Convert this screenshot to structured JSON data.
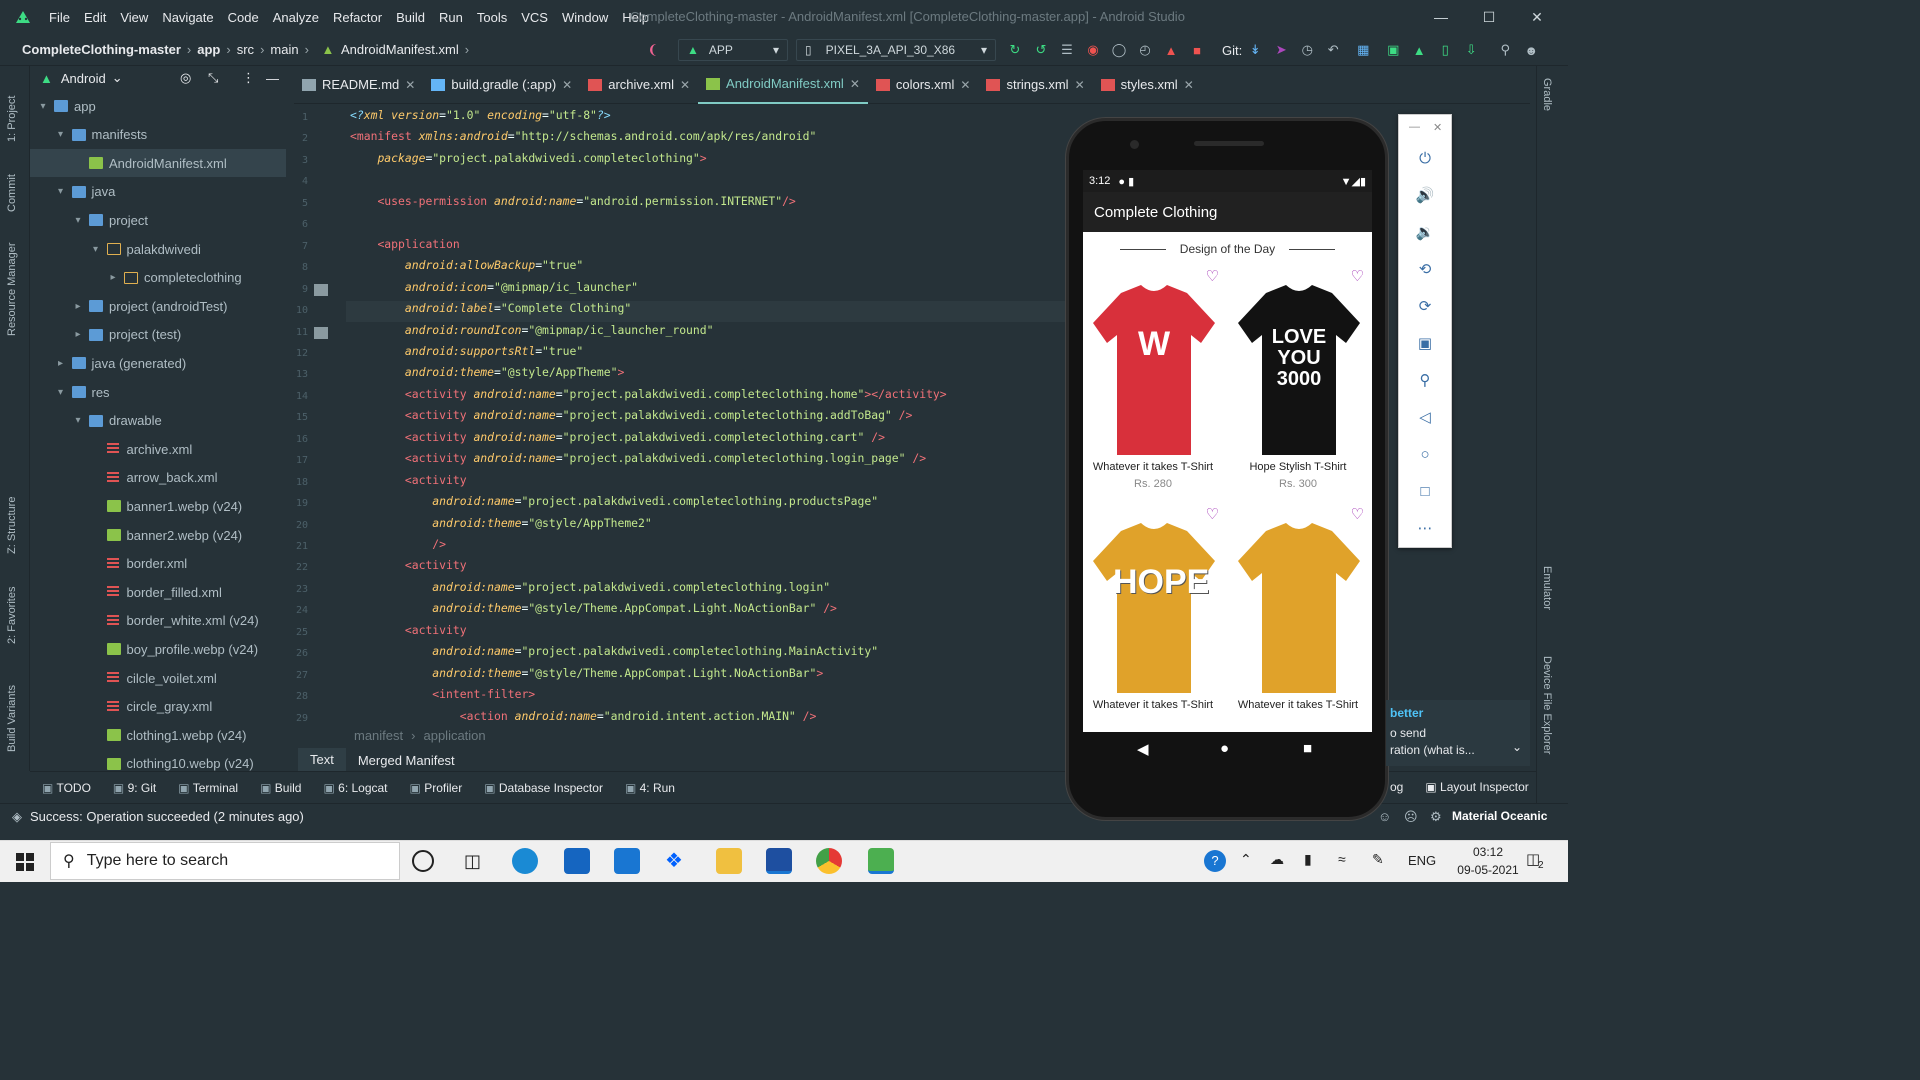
{
  "window": {
    "title": "CompleteClothing-master - AndroidManifest.xml [CompleteClothing-master.app] - Android Studio",
    "menu": [
      "File",
      "Edit",
      "View",
      "Navigate",
      "Code",
      "Analyze",
      "Refactor",
      "Build",
      "Run",
      "Tools",
      "VCS",
      "Window",
      "Help"
    ]
  },
  "breadcrumb": [
    "CompleteClothing-master",
    "app",
    "src",
    "main",
    "AndroidManifest.xml"
  ],
  "toolbar": {
    "run_config": "APP",
    "device": "PIXEL_3A_API_30_X86",
    "git_label": "Git:"
  },
  "left_strip_tabs": [
    "1: Project",
    "Commit",
    "Resource Manager",
    "Z: Structure",
    "2: Favorites",
    "Build Variants"
  ],
  "project_panel": {
    "view_selector": "Android",
    "tree": [
      {
        "label": "app",
        "level": 0,
        "kind": "module",
        "expanded": true
      },
      {
        "label": "manifests",
        "level": 1,
        "kind": "folder",
        "expanded": true
      },
      {
        "label": "AndroidManifest.xml",
        "level": 2,
        "kind": "android",
        "selected": true
      },
      {
        "label": "java",
        "level": 1,
        "kind": "folder",
        "expanded": true
      },
      {
        "label": "project",
        "level": 2,
        "kind": "package",
        "expanded": true
      },
      {
        "label": "palakdwivedi",
        "level": 3,
        "kind": "package-y",
        "expanded": true
      },
      {
        "label": "completeclothing",
        "level": 4,
        "kind": "package-y",
        "expanded": false
      },
      {
        "label": "project (androidTest)",
        "level": 2,
        "kind": "package",
        "expanded": false
      },
      {
        "label": "project (test)",
        "level": 2,
        "kind": "package",
        "expanded": false
      },
      {
        "label": "java (generated)",
        "level": 1,
        "kind": "folder",
        "expanded": false
      },
      {
        "label": "res",
        "level": 1,
        "kind": "folder",
        "expanded": true
      },
      {
        "label": "drawable",
        "level": 2,
        "kind": "folder",
        "expanded": true
      },
      {
        "label": "archive.xml",
        "level": 3,
        "kind": "xml"
      },
      {
        "label": "arrow_back.xml",
        "level": 3,
        "kind": "xml"
      },
      {
        "label": "banner1.webp (v24)",
        "level": 3,
        "kind": "img"
      },
      {
        "label": "banner2.webp (v24)",
        "level": 3,
        "kind": "img"
      },
      {
        "label": "border.xml",
        "level": 3,
        "kind": "xml"
      },
      {
        "label": "border_filled.xml",
        "level": 3,
        "kind": "xml"
      },
      {
        "label": "border_white.xml (v24)",
        "level": 3,
        "kind": "xml"
      },
      {
        "label": "boy_profile.webp (v24)",
        "level": 3,
        "kind": "img"
      },
      {
        "label": "cilcle_voilet.xml",
        "level": 3,
        "kind": "xml"
      },
      {
        "label": "circle_gray.xml",
        "level": 3,
        "kind": "xml"
      },
      {
        "label": "clothing1.webp (v24)",
        "level": 3,
        "kind": "img"
      },
      {
        "label": "clothing10.webp (v24)",
        "level": 3,
        "kind": "img"
      }
    ]
  },
  "editor_tabs": [
    {
      "label": "README.md",
      "active": false,
      "icon": "md"
    },
    {
      "label": "build.gradle (:app)",
      "active": false,
      "icon": "gradle"
    },
    {
      "label": "archive.xml",
      "active": false,
      "icon": "xml"
    },
    {
      "label": "AndroidManifest.xml",
      "active": true,
      "icon": "android"
    },
    {
      "label": "colors.xml",
      "active": false,
      "icon": "xml"
    },
    {
      "label": "strings.xml",
      "active": false,
      "icon": "xml"
    },
    {
      "label": "styles.xml",
      "active": false,
      "icon": "xml"
    }
  ],
  "code_lines": [
    [
      [
        "pi",
        "<?"
      ],
      [
        "attr",
        "xml version"
      ],
      [
        "plain",
        "="
      ],
      [
        "str",
        "\"1.0\""
      ],
      [
        "attr",
        " encoding"
      ],
      [
        "plain",
        "="
      ],
      [
        "str",
        "\"utf-8\""
      ],
      [
        "pi",
        "?>"
      ]
    ],
    [
      [
        "tag",
        "<manifest "
      ],
      [
        "attr",
        "xmlns:android"
      ],
      [
        "plain",
        "="
      ],
      [
        "str",
        "\"http://schemas.android.com/apk/res/android\""
      ]
    ],
    [
      [
        "plain",
        "    "
      ],
      [
        "attr",
        "package"
      ],
      [
        "plain",
        "="
      ],
      [
        "str",
        "\"project.palakdwivedi.completeclothing\""
      ],
      [
        "tag",
        ">"
      ]
    ],
    [],
    [
      [
        "plain",
        "    "
      ],
      [
        "tag",
        "<uses-permission "
      ],
      [
        "attr",
        "android:name"
      ],
      [
        "plain",
        "="
      ],
      [
        "str",
        "\"android.permission.INTERNET\""
      ],
      [
        "tag",
        "/>"
      ]
    ],
    [],
    [
      [
        "plain",
        "    "
      ],
      [
        "tag",
        "<application"
      ]
    ],
    [
      [
        "plain",
        "        "
      ],
      [
        "attr",
        "android:allowBackup"
      ],
      [
        "plain",
        "="
      ],
      [
        "str",
        "\"true\""
      ]
    ],
    [
      [
        "plain",
        "        "
      ],
      [
        "attr",
        "android:icon"
      ],
      [
        "plain",
        "="
      ],
      [
        "str",
        "\"@mipmap/ic_launcher\""
      ]
    ],
    [
      [
        "plain",
        "        "
      ],
      [
        "attr",
        "android:label"
      ],
      [
        "plain",
        "="
      ],
      [
        "str",
        "\"Complete Clothing\""
      ]
    ],
    [
      [
        "plain",
        "        "
      ],
      [
        "attr",
        "android:roundIcon"
      ],
      [
        "plain",
        "="
      ],
      [
        "str",
        "\"@mipmap/ic_launcher_round\""
      ]
    ],
    [
      [
        "plain",
        "        "
      ],
      [
        "attr",
        "android:supportsRtl"
      ],
      [
        "plain",
        "="
      ],
      [
        "str",
        "\"true\""
      ]
    ],
    [
      [
        "plain",
        "        "
      ],
      [
        "attr",
        "android:theme"
      ],
      [
        "plain",
        "="
      ],
      [
        "str",
        "\"@style/AppTheme\""
      ],
      [
        "tag",
        ">"
      ]
    ],
    [
      [
        "plain",
        "        "
      ],
      [
        "tag",
        "<activity "
      ],
      [
        "attr",
        "android:name"
      ],
      [
        "plain",
        "="
      ],
      [
        "str",
        "\"project.palakdwivedi.completeclothing.home\""
      ],
      [
        "tag",
        "></activity>"
      ]
    ],
    [
      [
        "plain",
        "        "
      ],
      [
        "tag",
        "<activity "
      ],
      [
        "attr",
        "android:name"
      ],
      [
        "plain",
        "="
      ],
      [
        "str",
        "\"project.palakdwivedi.completeclothing.addToBag\""
      ],
      [
        "tag",
        " />"
      ]
    ],
    [
      [
        "plain",
        "        "
      ],
      [
        "tag",
        "<activity "
      ],
      [
        "attr",
        "android:name"
      ],
      [
        "plain",
        "="
      ],
      [
        "str",
        "\"project.palakdwivedi.completeclothing.cart\""
      ],
      [
        "tag",
        " />"
      ]
    ],
    [
      [
        "plain",
        "        "
      ],
      [
        "tag",
        "<activity "
      ],
      [
        "attr",
        "android:name"
      ],
      [
        "plain",
        "="
      ],
      [
        "str",
        "\"project.palakdwivedi.completeclothing.login_page\""
      ],
      [
        "tag",
        " />"
      ]
    ],
    [
      [
        "plain",
        "        "
      ],
      [
        "tag",
        "<activity"
      ]
    ],
    [
      [
        "plain",
        "            "
      ],
      [
        "attr",
        "android:name"
      ],
      [
        "plain",
        "="
      ],
      [
        "str",
        "\"project.palakdwivedi.completeclothing.productsPage\""
      ]
    ],
    [
      [
        "plain",
        "            "
      ],
      [
        "attr",
        "android:theme"
      ],
      [
        "plain",
        "="
      ],
      [
        "str",
        "\"@style/AppTheme2\""
      ]
    ],
    [
      [
        "plain",
        "            "
      ],
      [
        "tag",
        "/>"
      ]
    ],
    [
      [
        "plain",
        "        "
      ],
      [
        "tag",
        "<activity"
      ]
    ],
    [
      [
        "plain",
        "            "
      ],
      [
        "attr",
        "android:name"
      ],
      [
        "plain",
        "="
      ],
      [
        "str",
        "\"project.palakdwivedi.completeclothing.login\""
      ]
    ],
    [
      [
        "plain",
        "            "
      ],
      [
        "attr",
        "android:theme"
      ],
      [
        "plain",
        "="
      ],
      [
        "str",
        "\"@style/Theme.AppCompat.Light.NoActionBar\""
      ],
      [
        "tag",
        " />"
      ]
    ],
    [
      [
        "plain",
        "        "
      ],
      [
        "tag",
        "<activity"
      ]
    ],
    [
      [
        "plain",
        "            "
      ],
      [
        "attr",
        "android:name"
      ],
      [
        "plain",
        "="
      ],
      [
        "str",
        "\"project.palakdwivedi.completeclothing.MainActivity\""
      ]
    ],
    [
      [
        "plain",
        "            "
      ],
      [
        "attr",
        "android:theme"
      ],
      [
        "plain",
        "="
      ],
      [
        "str",
        "\"@style/Theme.AppCompat.Light.NoActionBar\""
      ],
      [
        "tag",
        ">"
      ]
    ],
    [
      [
        "plain",
        "            "
      ],
      [
        "tag",
        "<intent-filter>"
      ]
    ],
    [
      [
        "plain",
        "                "
      ],
      [
        "tag",
        "<action "
      ],
      [
        "attr",
        "android:name"
      ],
      [
        "plain",
        "="
      ],
      [
        "str",
        "\"android.intent.action.MAIN\""
      ],
      [
        "tag",
        " />"
      ]
    ]
  ],
  "current_line": 10,
  "editor_breadcrumb": [
    "manifest",
    "application"
  ],
  "editor_bottom_tabs": [
    {
      "label": "Text",
      "active": true
    },
    {
      "label": "Merged Manifest",
      "active": false
    }
  ],
  "tool_windows": [
    "TODO",
    "9: Git",
    "Terminal",
    "Build",
    "6: Logcat",
    "Profiler",
    "Database Inspector",
    "4: Run"
  ],
  "tool_windows_right": [
    "og",
    "Layout Inspector"
  ],
  "status": {
    "message": "Success: Operation succeeded (2 minutes ago)",
    "theme": "Material Oceanic"
  },
  "right_strip_tabs": [
    "Gradle",
    "Emulator",
    "Device File Explorer"
  ],
  "tip": {
    "title": "better",
    "lines": [
      "o send",
      "ration (what is..."
    ]
  },
  "emulator": {
    "time": "3:12",
    "app_title": "Complete Clothing",
    "section_title": "Design of the Day",
    "products": [
      {
        "name": "Whatever it takes T-Shirt",
        "price": "Rs. 280",
        "shirt_color": "#d8303b",
        "print": "W"
      },
      {
        "name": "Hope Stylish T-Shirt",
        "price": "Rs. 300",
        "shirt_color": "#121212",
        "print": "LOVE YOU 3000"
      },
      {
        "name": "Whatever it takes T-Shirt",
        "price": "",
        "shirt_color": "#e0a22a",
        "print": "HOPE"
      },
      {
        "name": "Whatever it takes T-Shirt",
        "price": "",
        "shirt_color": "#e0a22a",
        "print": ""
      }
    ],
    "toolbar_icons": [
      "power-icon",
      "volume-up-icon",
      "volume-down-icon",
      "rotate-left-icon",
      "rotate-right-icon",
      "camera-icon",
      "zoom-icon",
      "back-icon",
      "home-icon",
      "overview-icon",
      "more-icon"
    ]
  },
  "taskbar": {
    "search_placeholder": "Type here to search",
    "time": "03:12",
    "date": "09-05-2021",
    "lang": "ENG",
    "notif_count": "2"
  },
  "colors": {
    "bg": "#263238",
    "accent": "#80cbc4",
    "tag": "#f07178",
    "attr": "#ffcb6b",
    "string": "#c3e88d"
  }
}
